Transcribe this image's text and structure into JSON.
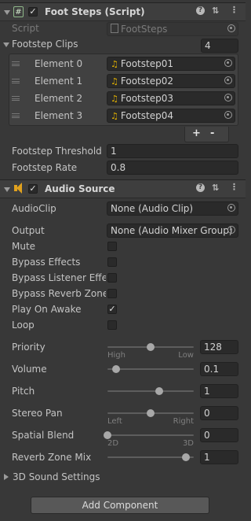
{
  "footsteps": {
    "title": "Foot Steps (Script)",
    "enabled": true,
    "script_label": "Script",
    "script_value": "FootSteps",
    "clips_label": "Footstep Clips",
    "clips_count": "4",
    "elements": [
      {
        "label": "Element 0",
        "value": "Footstep01"
      },
      {
        "label": "Element 1",
        "value": "Footstep02"
      },
      {
        "label": "Element 2",
        "value": "Footstep03"
      },
      {
        "label": "Element 3",
        "value": "Footstep04"
      }
    ],
    "add_label": "+",
    "remove_label": "-",
    "threshold_label": "Footstep Threshold",
    "threshold_value": "1",
    "rate_label": "Footstep Rate",
    "rate_value": "0.8"
  },
  "audio": {
    "title": "Audio Source",
    "enabled": true,
    "clip_label": "AudioClip",
    "clip_value": "None (Audio Clip)",
    "output_label": "Output",
    "output_value": "None (Audio Mixer Group)",
    "toggles": [
      {
        "label": "Mute",
        "checked": false
      },
      {
        "label": "Bypass Effects",
        "checked": false
      },
      {
        "label": "Bypass Listener Effects",
        "checked": false
      },
      {
        "label": "Bypass Reverb Zones",
        "checked": false
      },
      {
        "label": "Play On Awake",
        "checked": true
      },
      {
        "label": "Loop",
        "checked": false
      }
    ],
    "sliders": [
      {
        "label": "Priority",
        "value": "128",
        "fraction": 0.5,
        "min_label": "High",
        "max_label": "Low"
      },
      {
        "label": "Volume",
        "value": "0.1",
        "fraction": 0.1,
        "min_label": "",
        "max_label": ""
      },
      {
        "label": "Pitch",
        "value": "1",
        "fraction": 0.6,
        "min_label": "",
        "max_label": ""
      },
      {
        "label": "Stereo Pan",
        "value": "0",
        "fraction": 0.5,
        "min_label": "Left",
        "max_label": "Right"
      },
      {
        "label": "Spatial Blend",
        "value": "0",
        "fraction": 0.0,
        "min_label": "2D",
        "max_label": "3D"
      },
      {
        "label": "Reverb Zone Mix",
        "value": "1",
        "fraction": 0.91,
        "min_label": "",
        "max_label": ""
      }
    ],
    "sound_3d_label": "3D Sound Settings"
  },
  "add_component_label": "Add Component",
  "icons": [
    "script-icon",
    "help-icon",
    "settings-icon",
    "more-icon",
    "audio-icon",
    "music-note-icon",
    "object-picker-icon",
    "drag-handle-icon"
  ]
}
